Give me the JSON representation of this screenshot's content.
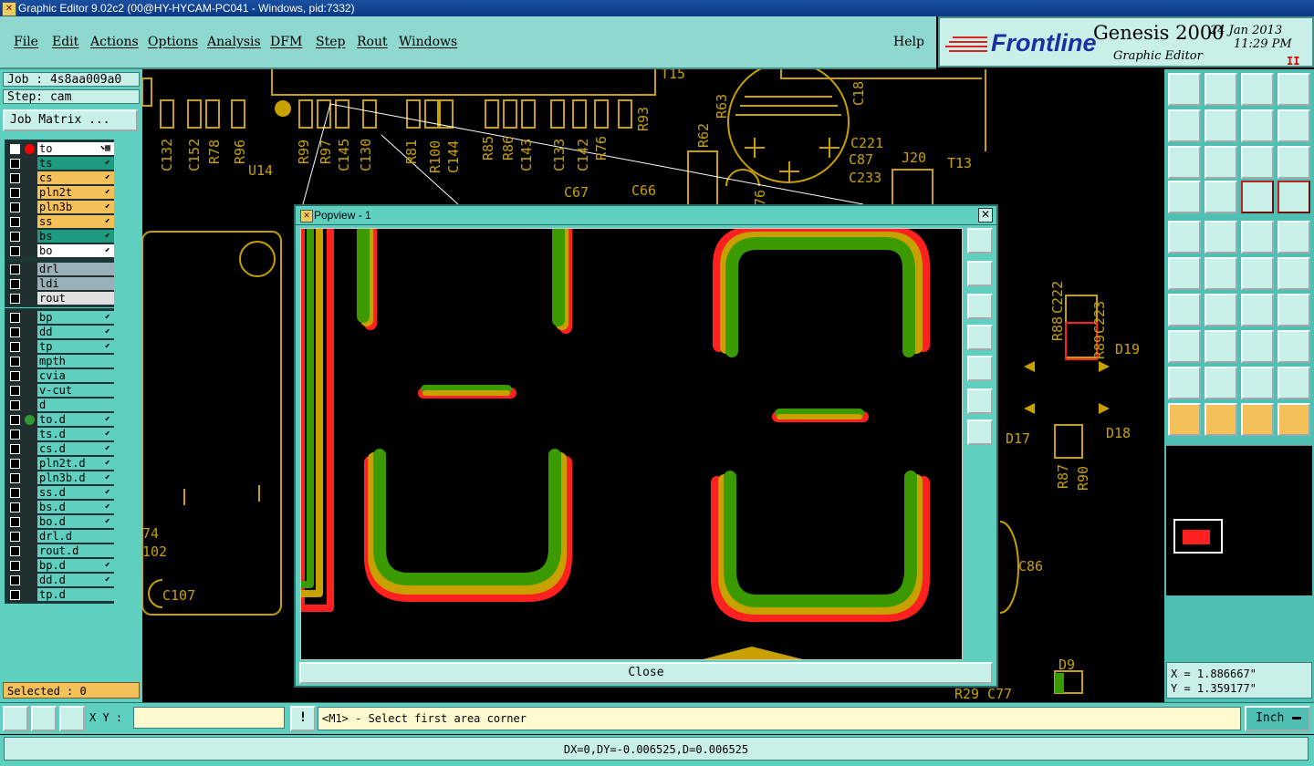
{
  "titlebar": {
    "text": "Graphic Editor 9.02c2 (00@HY-HYCAM-PC041 - Windows, pid:7332)"
  },
  "menu": {
    "file": "File",
    "edit": "Edit",
    "actions": "Actions",
    "options": "Options",
    "analysis": "Analysis",
    "dfm": "DFM",
    "step": "Step",
    "rout": "Rout",
    "windows": "Windows",
    "help": "Help"
  },
  "brand": {
    "logo": "Frontline",
    "product": "Genesis 2000",
    "subtitle": "Graphic Editor",
    "date": "24 Jan 2013",
    "time": "11:29 PM",
    "indicator": "II"
  },
  "job": {
    "job_label": "Job : 4s8aa009a0",
    "step_label": "Step: cam",
    "matrix_button": "Job Matrix ..."
  },
  "layers": {
    "group1": [
      {
        "name": "to",
        "color": "#ffffff",
        "active": true,
        "dot": "#ff0000",
        "arrow": "⬊▦"
      },
      {
        "name": "ts",
        "color": "#1e9a80",
        "arrow": "⬋"
      },
      {
        "name": "cs",
        "color": "#f3c05a",
        "arrow": "⬋"
      },
      {
        "name": "pln2t",
        "color": "#f3c05a",
        "arrow": "⬋"
      },
      {
        "name": "pln3b",
        "color": "#f3c05a",
        "arrow": "⬋"
      },
      {
        "name": "ss",
        "color": "#f3c05a",
        "arrow": "⬋"
      },
      {
        "name": "bs",
        "color": "#1e9a80",
        "arrow": "⬋"
      },
      {
        "name": "bo",
        "color": "#ffffff",
        "arrow": "⬋"
      }
    ],
    "group2": [
      {
        "name": "drl",
        "color": "#9ab0b8"
      },
      {
        "name": "ldi",
        "color": "#9ab0b8"
      },
      {
        "name": "rout",
        "color": "#e0e0e0"
      }
    ],
    "group3": [
      {
        "name": "bp",
        "color": "#5fcfc0",
        "arrow": "⬋"
      },
      {
        "name": "dd",
        "color": "#5fcfc0",
        "arrow": "⬋"
      },
      {
        "name": "tp",
        "color": "#5fcfc0",
        "arrow": "⬋"
      },
      {
        "name": "mpth",
        "color": "#5fcfc0"
      },
      {
        "name": "cvia",
        "color": "#5fcfc0"
      },
      {
        "name": "v-cut",
        "color": "#5fcfc0"
      },
      {
        "name": "d",
        "color": "#5fcfc0"
      },
      {
        "name": "to.d",
        "color": "#5fcfc0",
        "dot": "#2f9a2f",
        "arrow": "⬋"
      },
      {
        "name": "ts.d",
        "color": "#5fcfc0",
        "arrow": "⬋"
      },
      {
        "name": "cs.d",
        "color": "#5fcfc0",
        "arrow": "⬋"
      },
      {
        "name": "pln2t.d",
        "color": "#5fcfc0",
        "arrow": "⬋"
      },
      {
        "name": "pln3b.d",
        "color": "#5fcfc0",
        "arrow": "⬋"
      },
      {
        "name": "ss.d",
        "color": "#5fcfc0",
        "arrow": "⬋"
      },
      {
        "name": "bs.d",
        "color": "#5fcfc0",
        "arrow": "⬋"
      },
      {
        "name": "bo.d",
        "color": "#5fcfc0",
        "arrow": "⬋"
      },
      {
        "name": "drl.d",
        "color": "#5fcfc0"
      },
      {
        "name": "rout.d",
        "color": "#5fcfc0"
      },
      {
        "name": "bp.d",
        "color": "#5fcfc0",
        "arrow": "⬋"
      },
      {
        "name": "dd.d",
        "color": "#5fcfc0",
        "arrow": "⬋"
      },
      {
        "name": "tp.d",
        "color": "#5fcfc0"
      }
    ]
  },
  "selected": {
    "text": "Selected : 0"
  },
  "board_labels": {
    "t15": "T15",
    "c132": "C132",
    "c152": "C152",
    "r78": "R78",
    "r96": "R96",
    "u14": "U14",
    "r99": "R99",
    "r97": "R97",
    "c145": "C145",
    "c130": "C130",
    "r81": "R81",
    "r100": "R100",
    "c144": "C144",
    "r85": "R85",
    "r86": "R86",
    "c143": "C143",
    "c133": "C133",
    "c142": "C142",
    "r76": "R76",
    "r93": "R93",
    "r62": "R62",
    "r63": "R63",
    "c18": "C18",
    "c221": "C221",
    "c87": "C87",
    "c233": "C233",
    "j20": "J20",
    "t13": "T13",
    "c67": "C67",
    "c66": "C66",
    "r88": "R88",
    "c222": "C222",
    "r89": "R89",
    "c223": "C223",
    "d19": "D19",
    "d17": "D17",
    "d18": "D18",
    "r87": "R87",
    "r90": "R90",
    "n74": "74",
    "n102": "102",
    "c107": "C107",
    "c86": "C86",
    "d9": "D9",
    "r29": "R29",
    "c77": "C77",
    "n76": "76"
  },
  "popview": {
    "title": "Popview - 1",
    "close_button": "Close",
    "close_icon": "✕"
  },
  "coords": {
    "x": "X = 1.886667\"",
    "y": "Y = 1.359177\""
  },
  "command": {
    "xy_label": "X Y :",
    "xy_value": "",
    "prompt": "<M1> - Select first area corner",
    "units": "Inch",
    "warn": "!"
  },
  "status": {
    "text": "DX=0,DY=-0.006525,D=0.006525"
  },
  "colors": {
    "accent": "#5fcfc0",
    "panel": "#c9efe9",
    "copper": "#c8a000",
    "top": "#ff2020",
    "bottom": "#3a9a00"
  }
}
